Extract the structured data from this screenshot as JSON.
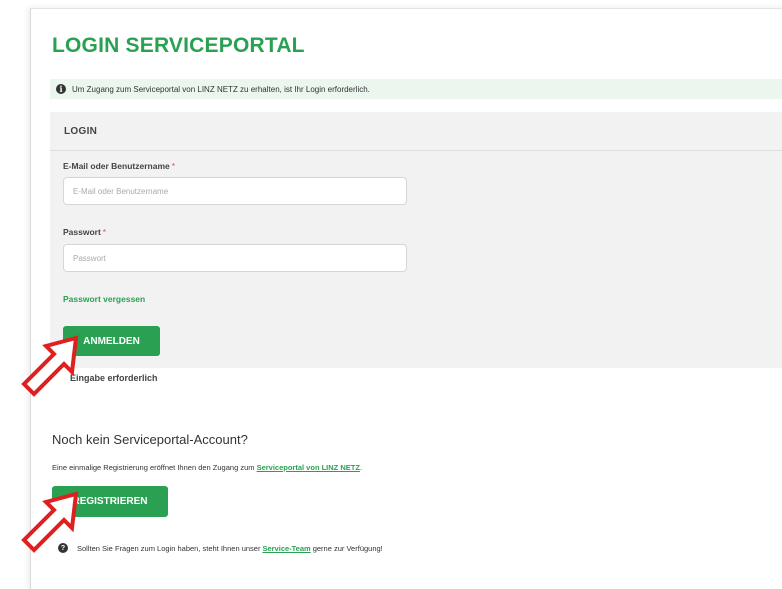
{
  "page": {
    "title": "LOGIN SERVICEPORTAL"
  },
  "info": {
    "icon": "info-icon",
    "text": "Um Zugang zum Serviceportal von LINZ NETZ zu erhalten, ist Ihr Login erforderlich."
  },
  "login_panel": {
    "header": "LOGIN",
    "username": {
      "label": "E-Mail oder Benutzername",
      "required_mark": "*",
      "placeholder": "E-Mail oder Benutzername",
      "value": ""
    },
    "password": {
      "label": "Passwort",
      "required_mark": "*",
      "placeholder": "Passwort",
      "value": ""
    },
    "forgot_password_link": "Passwort vergessen",
    "submit_button": "ANMELDEN"
  },
  "required_note": "Eingabe erforderlich",
  "registration": {
    "title": "Noch kein Serviceportal-Account?",
    "text_before": "Eine einmalige Registrierung eröffnet Ihnen den Zugang zum ",
    "link": "Serviceportal von LINZ NETZ",
    "text_after": ".",
    "button": "REGISTRIEREN"
  },
  "help": {
    "icon": "question-circle-icon",
    "text_before": "Sollten Sie Fragen zum Login haben, steht Ihnen unser ",
    "link": "Service-Team",
    "text_after": " gerne zur Verfügung!"
  },
  "colors": {
    "brand_green": "#2aa152",
    "info_background": "#eaf6ee",
    "panel_background": "#f2f2f2",
    "annotation_arrow": "#e02020"
  }
}
